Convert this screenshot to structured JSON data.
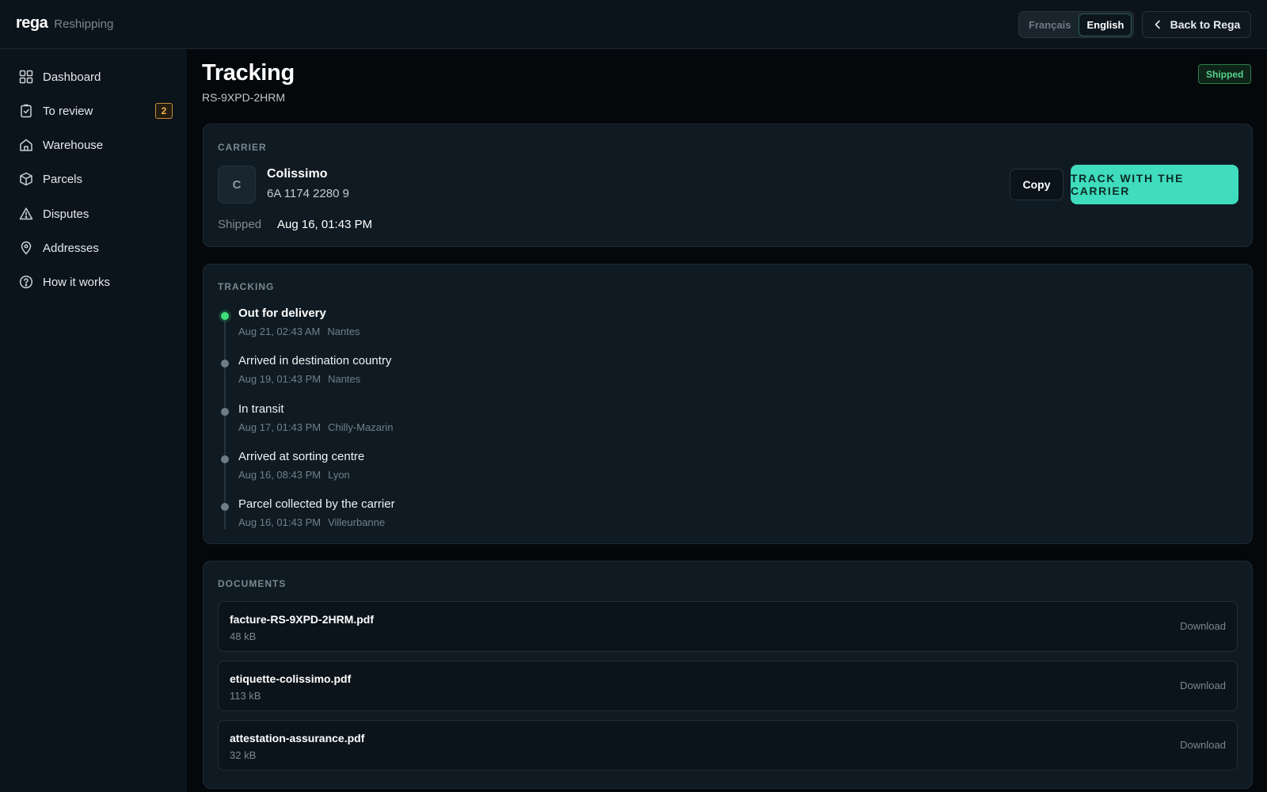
{
  "app": {
    "brand": "rega",
    "section": "Reshipping"
  },
  "header": {
    "languages": [
      {
        "label": "Français",
        "active": false
      },
      {
        "label": "English",
        "active": true
      }
    ],
    "back_label": "Back to Rega"
  },
  "sidebar": {
    "items": [
      {
        "label": "Dashboard",
        "icon": "grid-icon"
      },
      {
        "label": "To review",
        "icon": "clipboard-check-icon",
        "badge": "2"
      },
      {
        "label": "Warehouse",
        "icon": "home-icon"
      },
      {
        "label": "Parcels",
        "icon": "box-icon"
      },
      {
        "label": "Disputes",
        "icon": "warning-triangle-icon"
      },
      {
        "label": "Addresses",
        "icon": "map-pin-icon"
      },
      {
        "label": "How it works",
        "icon": "help-circle-icon"
      }
    ]
  },
  "page": {
    "title": "Tracking",
    "reference": "RS-9XPD-2HRM",
    "status": "Shipped",
    "status_color": "#56d18c"
  },
  "carrier": {
    "heading": "CARRIER",
    "logo_letter": "C",
    "name": "Colissimo",
    "tracking_number": "6A 1174 2280 9",
    "shipped_label": "Shipped",
    "shipped_value": "Aug 16, 01:43 PM",
    "copy_label": "Copy",
    "track_label": "TRACK WITH THE CARRIER",
    "accent": "#3fdcbd"
  },
  "tracking": {
    "heading": "TRACKING",
    "events": [
      {
        "title": "Out for delivery",
        "date": "Aug 21, 02:43 AM",
        "location": "Nantes",
        "active": true
      },
      {
        "title": "Arrived in destination country",
        "date": "Aug 19, 01:43 PM",
        "location": "Nantes",
        "active": false
      },
      {
        "title": "In transit",
        "date": "Aug 17, 01:43 PM",
        "location": "Chilly-Mazarin",
        "active": false
      },
      {
        "title": "Arrived at sorting centre",
        "date": "Aug 16, 08:43 PM",
        "location": "Lyon",
        "active": false
      },
      {
        "title": "Parcel collected by the carrier",
        "date": "Aug 16, 01:43 PM",
        "location": "Villeurbanne",
        "active": false
      }
    ]
  },
  "documents": {
    "heading": "DOCUMENTS",
    "items": [
      {
        "name": "facture-RS-9XPD-2HRM.pdf",
        "size": "48 kB",
        "action": "Download"
      },
      {
        "name": "etiquette-colissimo.pdf",
        "size": "113 kB",
        "action": "Download"
      },
      {
        "name": "attestation-assurance.pdf",
        "size": "32 kB",
        "action": "Download"
      }
    ]
  }
}
